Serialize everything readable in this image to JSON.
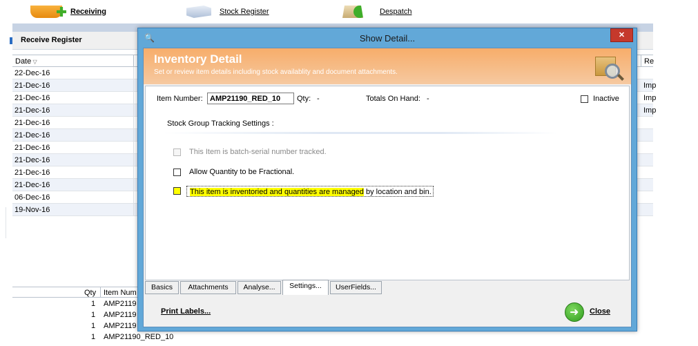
{
  "toolbar": {
    "receiving": "Receiving",
    "stock_register": "Stock Register",
    "despatch": "Despatch"
  },
  "register": {
    "title": "Receive Register",
    "col_date": "Date",
    "col_re": "Re",
    "rows": [
      {
        "date": "22-Dec-16",
        "re": ""
      },
      {
        "date": "21-Dec-16",
        "re": "Imp"
      },
      {
        "date": "21-Dec-16",
        "re": "Imp"
      },
      {
        "date": "21-Dec-16",
        "re": "Imp"
      },
      {
        "date": "21-Dec-16",
        "re": ""
      },
      {
        "date": "21-Dec-16",
        "re": ""
      },
      {
        "date": "21-Dec-16",
        "re": ""
      },
      {
        "date": "21-Dec-16",
        "re": ""
      },
      {
        "date": "21-Dec-16",
        "re": ""
      },
      {
        "date": "21-Dec-16",
        "re": ""
      },
      {
        "date": "06-Dec-16",
        "re": ""
      },
      {
        "date": "19-Nov-16",
        "re": ""
      }
    ],
    "lower_col_qty": "Qty",
    "lower_col_item": "Item Num",
    "lower_rows": [
      {
        "qty": "1",
        "item": "AMP2119"
      },
      {
        "qty": "1",
        "item": "AMP2119"
      },
      {
        "qty": "1",
        "item": "AMP2119"
      },
      {
        "qty": "1",
        "item": "AMP21190_RED_10"
      }
    ]
  },
  "dialog": {
    "title": "Show Detail...",
    "close_glyph": "✕",
    "banner_title": "Inventory Detail",
    "banner_subtitle": "Set or review item details including stock availablity and document attachments.",
    "item_number_label": "Item Number:",
    "item_number_value": "AMP21190_RED_10",
    "qty_label": "Qty:",
    "qty_value": "-",
    "totals_label": "Totals On Hand:",
    "totals_value": "-",
    "inactive_label": "Inactive",
    "section_heading": "Stock Group Tracking Settings :",
    "batch_serial_label": "This Item is batch-serial number tracked.",
    "fractional_label": "Allow Quantity to be Fractional.",
    "inventoried_label_highlight": "This item is inventoried and quantities are managed",
    "inventoried_label_rest": " by location and bin.",
    "tabs": [
      "Basics",
      "Attachments",
      "Analyse...",
      "Settings...",
      "UserFields..."
    ],
    "active_tab": "Settings...",
    "print_labels": "Print Labels...",
    "close_label": "Close"
  }
}
